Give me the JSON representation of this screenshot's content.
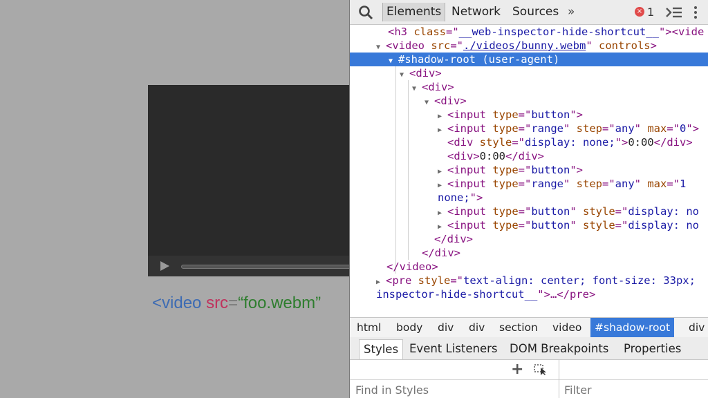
{
  "page": {
    "code_tag": "<video",
    "code_attr": "src",
    "code_eq": "=",
    "code_value": "“foo.webm”"
  },
  "devtools": {
    "tabs": [
      "Elements",
      "Network",
      "Sources"
    ],
    "more_tabs": "»",
    "error_count": "1",
    "error_icon_glyph": "×",
    "dom": {
      "r0": {
        "t1": "<h3 ",
        "a1": "class",
        "eq": "=\"",
        "v1": "__web-inspector-hide-shortcut__",
        "end": "\"><vide"
      },
      "r1": {
        "t1": "<video ",
        "a1": "src",
        "eq": "=\"",
        "v1": "./videos/bunny.webm",
        "q": "\" ",
        "a2": "controls",
        "end": ">"
      },
      "r2": {
        "text": "#shadow-root (user-agent)"
      },
      "r3": {
        "text": "<div>"
      },
      "r4": {
        "text": "<div>"
      },
      "r5": {
        "text": "<div>"
      },
      "r6": {
        "t1": "<input ",
        "a1": "type",
        "eq": "=\"",
        "v1": "button",
        "end": "\">"
      },
      "r7": {
        "t1": "<input ",
        "a1": "type",
        "eq": "=\"",
        "v1": "range",
        "q": "\" ",
        "a2": "step",
        "eq2": "=\"",
        "v2": "any",
        "q2": "\" ",
        "a3": "max",
        "eq3": "=\"",
        "v3": "0",
        "end": "\">"
      },
      "r8": {
        "t1": "<div ",
        "a1": "style",
        "eq": "=\"",
        "v1": "display: none;",
        "q": "\">",
        "txt": "0:00",
        "end": "</div>"
      },
      "r9": {
        "t1": "<div>",
        "txt": "0:00",
        "end": "</div>"
      },
      "r10": {
        "t1": "<input ",
        "a1": "type",
        "eq": "=\"",
        "v1": "button",
        "end": "\">"
      },
      "r11": {
        "t1": "<input ",
        "a1": "type",
        "eq": "=\"",
        "v1": "range",
        "q": "\" ",
        "a2": "step",
        "eq2": "=\"",
        "v2": "any",
        "q2": "\" ",
        "a3": "max",
        "eq3": "=\"",
        "v3": "1"
      },
      "r12": {
        "v1": "none;",
        "end": "\">"
      },
      "r13": {
        "t1": "<input ",
        "a1": "type",
        "eq": "=\"",
        "v1": "button",
        "q": "\" ",
        "a2": "style",
        "eq2": "=\"",
        "v2": "display: no"
      },
      "r14": {
        "t1": "<input ",
        "a1": "type",
        "eq": "=\"",
        "v1": "button",
        "q": "\" ",
        "a2": "style",
        "eq2": "=\"",
        "v2": "display: no"
      },
      "r15": {
        "text": "</div>"
      },
      "r16": {
        "text": "</div>"
      },
      "r17": {
        "text": "</video>"
      },
      "r18": {
        "t1": "<pre ",
        "a1": "style",
        "eq": "=\"",
        "v1": "text-align: center; font-size: 33px;"
      },
      "r19": {
        "v1": "inspector-hide-shortcut__",
        "end": "\">…</pre>"
      }
    },
    "breadcrumbs": [
      "html",
      "body",
      "div",
      "div",
      "section",
      "video",
      "#shadow-root",
      "div"
    ],
    "sidebar_tabs": [
      "Styles",
      "Event Listeners",
      "DOM Breakpoints",
      "Properties"
    ],
    "add_rule": "+",
    "find_placeholder": "Find in Styles",
    "filter_placeholder": "Filter"
  }
}
